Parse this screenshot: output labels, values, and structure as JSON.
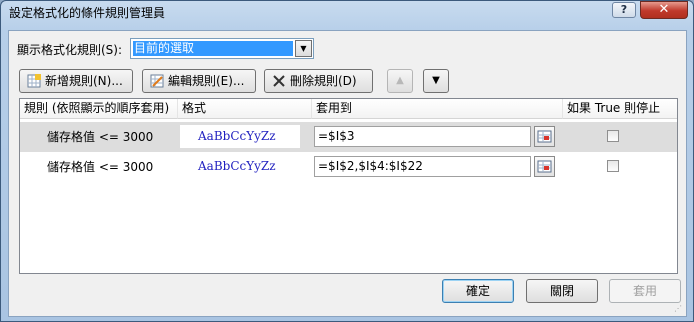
{
  "window": {
    "title": "設定格式化的條件規則管理員",
    "help_label": "?",
    "close_label": "✕"
  },
  "show_rules": {
    "label": "顯示格式化規則(S):",
    "selected": "目前的選取"
  },
  "toolbar": {
    "new_rule": "新增規則(N)...",
    "edit_rule": "編輯規則(E)...",
    "delete_rule": "刪除規則(D)",
    "move_up_icon": "triangle-up-icon",
    "move_down_icon": "triangle-down-icon"
  },
  "columns": {
    "rule": "規則 (依照顯示的順序套用)",
    "format": "格式",
    "applies_to": "套用到",
    "stop_if_true": "如果 True 則停止"
  },
  "rules": [
    {
      "rule": "儲存格值 <= 3000",
      "format_preview": "AaBbCcYyZz",
      "applies_to": "=$I$3",
      "stop_if_true": false,
      "selected": true
    },
    {
      "rule": "儲存格值 <= 3000",
      "format_preview": "AaBbCcYyZz",
      "applies_to": "=$I$2,$I$4:$I$22",
      "stop_if_true": false,
      "selected": false
    }
  ],
  "footer": {
    "ok": "確定",
    "close": "關閉",
    "apply": "套用"
  },
  "colors": {
    "selection": "#3399ff",
    "preview_text": "#1f1fbf",
    "close_button": "#c0392b"
  }
}
